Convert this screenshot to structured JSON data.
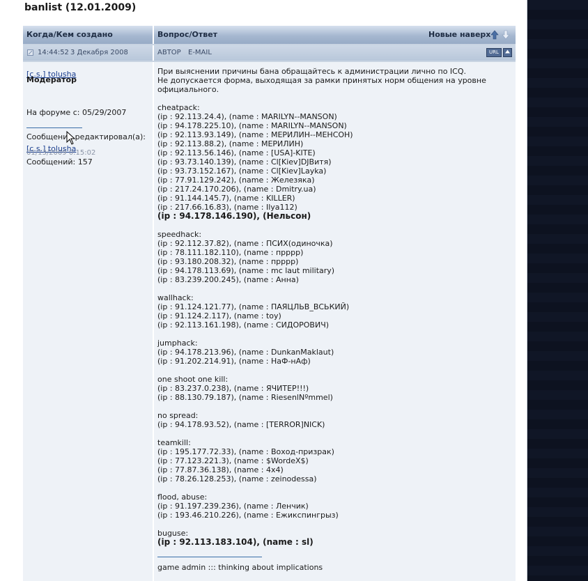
{
  "page": {
    "title": "banlist (12.01.2009)"
  },
  "header": {
    "left_label": "Когда/Кем создано",
    "right_label": "Вопрос/Ответ",
    "sort_label": "Новые наверх"
  },
  "post_meta": {
    "time": "14:44:52",
    "date": "3 Декабря 2008",
    "author_label": "АВТОР",
    "email_label": "E-MAIL",
    "url_button": "URL"
  },
  "author": {
    "name": "[c.s.] tolusha",
    "role": "Модератор",
    "forum_since": "На форуме с: 05/29/2007",
    "edited_by_label": "Сообщение редактировал(а):",
    "edited_by_name": "[c.s.] tolusha",
    "edited_date": "01/13/2009 0:15:02",
    "messages": "Сообщений: 157"
  },
  "post": {
    "intro1": "При выяснении причины бана обращайтесь к администрации лично по ICQ.",
    "intro2": "Не допускается форма, выходящая за рамки принятых норм общения на уровне официального.",
    "sections": [
      {
        "title": "cheatpack:",
        "lines": [
          "(ip : 92.113.24.4), (name : MARILYN--MANSON)",
          "(ip : 94.178.225.10), (name : MARILYN--MANSON)",
          "(ip : 92.113.93.149), (name : МЕРИЛИН--МЕНСОН)",
          "(ip : 92.113.88.2), (name : МЕРИЛИН)",
          "(ip : 92.113.56.146), (name : [USA]-KITE)",
          "(ip : 93.73.140.139), (name : Cl[Kiev]DJВитя)",
          "(ip : 93.73.152.167), (name : Cl[Kiev]Layka)",
          "(ip : 77.91.129.242), (name : Железяка)",
          "(ip : 217.24.170.206), (name : Dmitry.ua)",
          "(ip : 91.144.145.7), (name : KILLER)",
          "(ip : 217.66.16.83), (name : Ilya112)"
        ],
        "bold_line": "(ip : 94.178.146.190), (Нельсон)"
      },
      {
        "title": "speedhack:",
        "lines": [
          "(ip : 92.112.37.82), (name : ПСИХ(одиночка)",
          "(ip : 78.111.182.110), (name : прррр)",
          "(ip : 93.180.208.32), (name : прррр)",
          "(ip : 94.178.113.69), (name : mc laut military)",
          "(ip : 83.239.200.245), (name : Анна)"
        ]
      },
      {
        "title": "wallhack:",
        "lines": [
          "(ip : 91.124.121.77), (name : ПАЯЦЛЬВ_ВСЬКИЙ)",
          "(ip : 91.124.2.117), (name : toy)",
          "(ip : 92.113.161.198), (name : СИДОРОВИЧ)"
        ]
      },
      {
        "title": "jumphack:",
        "lines": [
          "(ip : 94.178.213.96), (name : DunkanMaklaut)",
          "(ip : 91.202.214.91), (name : НаФ-нАф)"
        ]
      },
      {
        "title": "one shoot one kill:",
        "lines": [
          "(ip : 83.237.0.238), (name : ЯЧИТЕР!!!)",
          "(ip : 88.130.79.187), (name : RiesenlNºmmel)"
        ]
      },
      {
        "title": "no spread:",
        "lines": [
          "(ip : 94.178.93.52), (name : [TERROR]NICK)"
        ]
      },
      {
        "title": "teamkill:",
        "lines": [
          "(ip : 195.177.72.33), (name : Воход-призрак)",
          "(ip : 77.123.221.3), (name : $WordeX$)",
          "(ip : 77.87.36.138), (name : 4x4)",
          "(ip : 78.26.128.253), (name : zeinodessa)"
        ]
      },
      {
        "title": "flood, abuse:",
        "lines": [
          "(ip : 91.197.239.236), (name : Ленчик)",
          "(ip : 193.46.210.226), (name : Ежикспингрыз)"
        ]
      }
    ],
    "buguse_title": "buguse:",
    "buguse_line": "(ip : 92.113.183.104), (name : sl)",
    "signature": "game admin ::: thinking about implications"
  }
}
